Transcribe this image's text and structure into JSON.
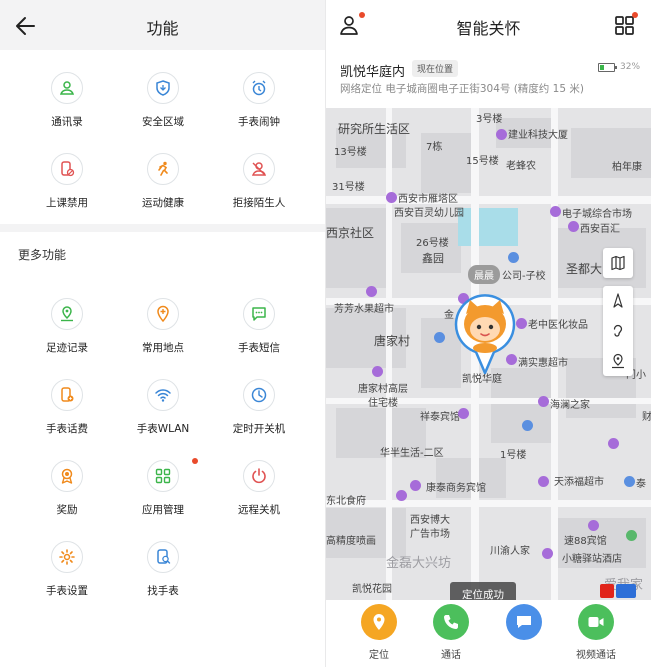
{
  "left": {
    "title": "功能",
    "section_more": "更多功能",
    "top_tiles": [
      {
        "label": "通讯录",
        "icon": "contacts-icon"
      },
      {
        "label": "安全区域",
        "icon": "safe-zone-icon"
      },
      {
        "label": "手表闹钟",
        "icon": "alarm-icon"
      },
      {
        "label": "上课禁用",
        "icon": "class-mode-icon"
      },
      {
        "label": "运动健康",
        "icon": "running-icon"
      },
      {
        "label": "拒接陌生人",
        "icon": "block-stranger-icon"
      }
    ],
    "more_tiles": [
      {
        "label": "足迹记录",
        "icon": "footprint-icon"
      },
      {
        "label": "常用地点",
        "icon": "favorite-place-icon"
      },
      {
        "label": "手表短信",
        "icon": "sms-icon"
      },
      {
        "label": "手表话费",
        "icon": "phone-bill-icon"
      },
      {
        "label": "手表WLAN",
        "icon": "wlan-icon"
      },
      {
        "label": "定时开关机",
        "icon": "timer-power-icon"
      },
      {
        "label": "奖励",
        "icon": "reward-icon"
      },
      {
        "label": "应用管理",
        "icon": "app-manage-icon"
      },
      {
        "label": "远程关机",
        "icon": "remote-power-icon"
      },
      {
        "label": "手表设置",
        "icon": "watch-settings-icon"
      },
      {
        "label": "找手表",
        "icon": "find-watch-icon"
      }
    ]
  },
  "right": {
    "title": "智能关怀",
    "location": {
      "name": "凯悦华庭内",
      "tag": "现在位置",
      "address": "网络定位  电子城商圈电子正街304号 (精度约 15 米)",
      "battery_text": "32%",
      "battery_level": 0.32
    },
    "map": {
      "labels": [
        "研究所生活区",
        "3号楼",
        "13号楼",
        "建业科技大厦",
        "7栋",
        "15号楼",
        "老蜂农",
        "柏年康",
        "31号楼",
        "西安市雁塔区",
        "西安百灵幼儿园",
        "电子城综合市场",
        "西京社区",
        "西安百汇",
        "26号楼",
        "鑫园",
        "公司-子校",
        "圣都大",
        "芳芳水果超市",
        "金",
        "老中医化妆品",
        "唐家村",
        "满实惠超市",
        "凯悦华庭",
        "门小",
        "唐家村高层",
        "住宅楼",
        "海澜之家",
        "祥泰宾馆",
        "财",
        "华半生活-二区",
        "1号楼",
        "天添福超市",
        "泰",
        "康泰商务宾馆",
        "东北食府",
        "西安博大",
        "广告市场",
        "速88宾馆",
        "高精度喷画",
        "川渝人家",
        "小糖驿站酒店",
        "金磊大兴坊",
        "凯悦花园",
        "爱我家"
      ],
      "wearer_name": "晨晨",
      "toast": "定位成功"
    },
    "bottom": [
      {
        "label": "定位",
        "icon": "location-pin-icon",
        "color": "#f5a623"
      },
      {
        "label": "通话",
        "icon": "phone-icon",
        "color": "#4cbf5c"
      },
      {
        "label": "",
        "icon": "chat-icon",
        "color": "#4a8fe8"
      },
      {
        "label": "视频通话",
        "icon": "video-call-icon",
        "color": "#4cbf5c"
      }
    ],
    "colors": {
      "accent_orange": "#f5a623",
      "accent_green": "#4cbf5c",
      "accent_blue": "#4a8fe8",
      "badge_red": "#e94a2b"
    }
  }
}
